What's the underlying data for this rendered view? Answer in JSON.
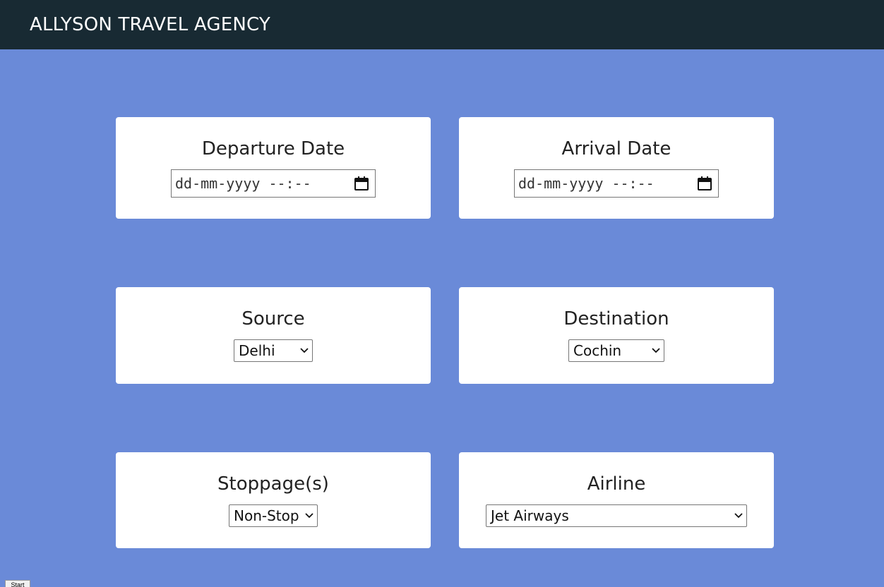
{
  "app": {
    "title": "ALLYSON TRAVEL AGENCY"
  },
  "departure": {
    "label": "Departure Date",
    "placeholder": "dd-mm-yyyy --:--",
    "icon": "calendar-icon"
  },
  "arrival": {
    "label": "Arrival Date",
    "placeholder": "dd-mm-yyyy --:--",
    "icon": "calendar-icon"
  },
  "source": {
    "label": "Source",
    "selected": "Delhi"
  },
  "destination": {
    "label": "Destination",
    "selected": "Cochin"
  },
  "stoppage": {
    "label": "Stoppage(s)",
    "selected": "Non-Stop"
  },
  "airline": {
    "label": "Airline",
    "selected": "Jet Airways"
  },
  "footer": {
    "start_label": "Start"
  },
  "colors": {
    "background": "#6a8ad8",
    "navbar": "#182a33",
    "card": "#ffffff"
  }
}
